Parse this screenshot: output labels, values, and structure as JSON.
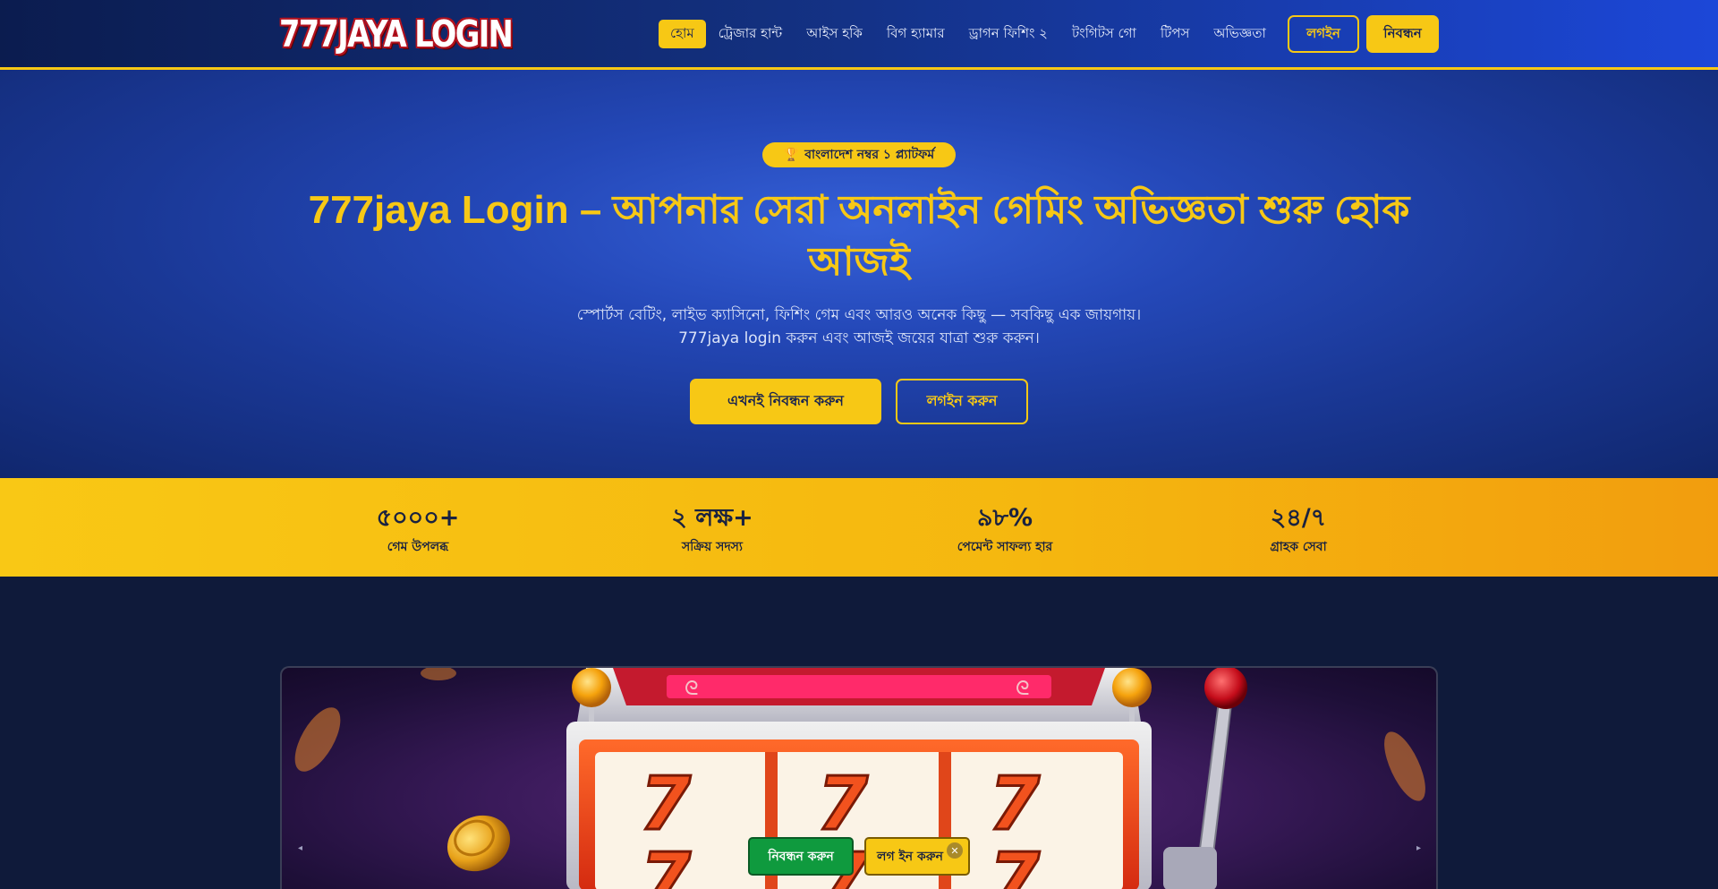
{
  "header": {
    "logo_text": "777JAYA LOGIN",
    "nav": [
      {
        "label": "হোম",
        "active": true
      },
      {
        "label": "ট্রেজার হান্ট",
        "active": false
      },
      {
        "label": "আইস হকি",
        "active": false
      },
      {
        "label": "বিগ হ্যামার",
        "active": false
      },
      {
        "label": "ড্রাগন ফিশিং ২",
        "active": false
      },
      {
        "label": "টংগিটস গো",
        "active": false
      },
      {
        "label": "টিপস",
        "active": false
      },
      {
        "label": "অভিজ্ঞতা",
        "active": false
      }
    ],
    "login_label": "লগইন",
    "register_label": "নিবন্ধন"
  },
  "hero": {
    "badge": "বাংলাদেশ নম্বর ১ প্ল্যাটফর্ম",
    "badge_icon": "trophy-icon",
    "title": "777jaya Login – আপনার সেরা অনলাইন গেমিং অভিজ্ঞতা শুরু হোক আজই",
    "subtitle_line1": "স্পোর্টস বেটিং, লাইভ ক্যাসিনো, ফিশিং গেম এবং আরও অনেক কিছু — সবকিছু এক জায়গায়।",
    "subtitle_line2": "777jaya login করুন এবং আজই জয়ের যাত্রা শুরু করুন।",
    "cta_register": "এখনই নিবন্ধন করুন",
    "cta_login": "লগইন করুন"
  },
  "stats": [
    {
      "value": "৫০০০+",
      "label": "গেম উপলব্ধ"
    },
    {
      "value": "২ লক্ষ+",
      "label": "সক্রিয় সদস্য"
    },
    {
      "value": "৯৮%",
      "label": "পেমেন্ট সাফল্য হার"
    },
    {
      "value": "২৪/৭",
      "label": "গ্রাহক সেবা"
    }
  ],
  "floating": {
    "register_label": "নিবন্ধন করুন",
    "login_label": "লগ ইন করুন",
    "close_glyph": "✕"
  },
  "colors": {
    "accent": "#f7c815",
    "nav_bg": "#13307f",
    "page_bg": "#0f1a3a",
    "float_register_bg": "#0f9a3e"
  },
  "image": {
    "reel_symbol": "7"
  }
}
